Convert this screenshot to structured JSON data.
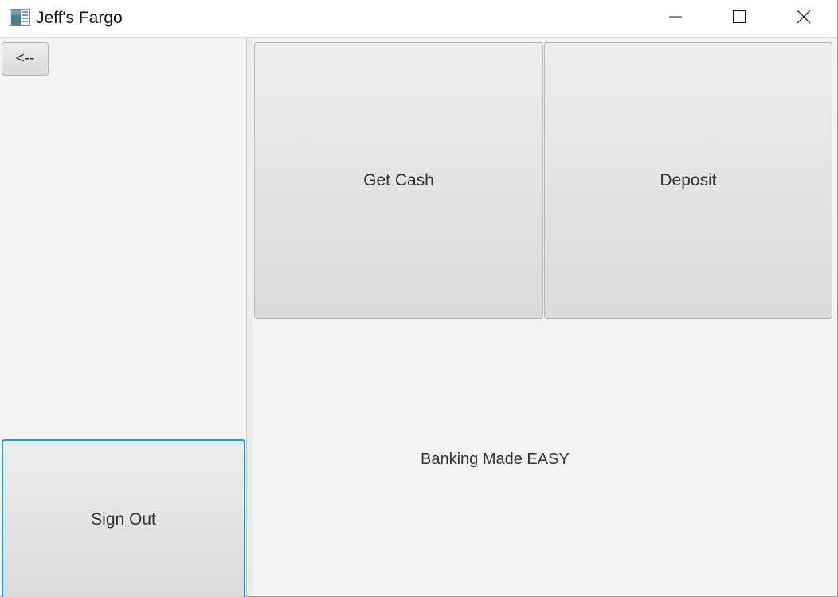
{
  "window": {
    "title": "Jeff's Fargo",
    "controls": {
      "minimize": "minimize-icon",
      "maximize": "maximize-icon",
      "close": "close-icon"
    }
  },
  "sidebar": {
    "back_label": "<--",
    "signout_label": "Sign Out"
  },
  "main": {
    "get_cash_label": "Get Cash",
    "deposit_label": "Deposit",
    "tagline": "Banking Made EASY"
  },
  "colors": {
    "focus_border": "#1a9ad6",
    "background": "#f3f3f3"
  }
}
